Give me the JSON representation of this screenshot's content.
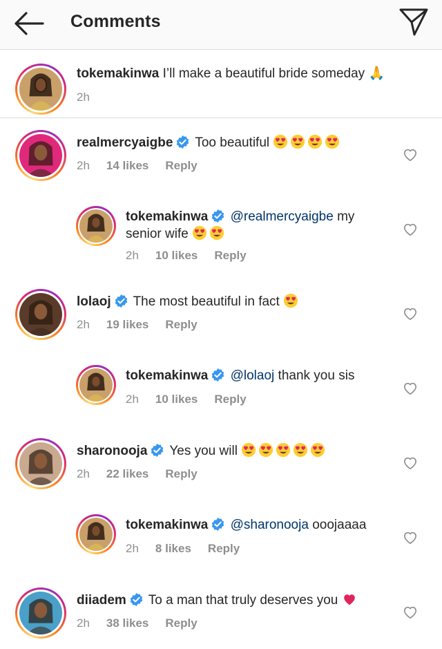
{
  "header": {
    "title": "Comments",
    "back_icon": "arrow-left-icon",
    "send_icon": "paper-plane-icon"
  },
  "caption": {
    "username": "tokemakinwa",
    "text": "I’ll make a beautiful bride someday",
    "emoji": "🙏",
    "time": "2h"
  },
  "comments": [
    {
      "username": "realmercyaigbe",
      "verified": true,
      "text": "Too beautiful",
      "emojis": [
        "😍",
        "😍",
        "😍",
        "😍"
      ],
      "time": "2h",
      "likes": "14 likes",
      "reply": "Reply",
      "avatar_color": "#e0297b"
    },
    {
      "username": "tokemakinwa",
      "verified": true,
      "mention": "@realmercyaigbe",
      "text": "my",
      "text2": "senior wife",
      "emojis": [
        "😍",
        "😍"
      ],
      "time": "2h",
      "likes": "10 likes",
      "reply": "Reply",
      "is_reply": true
    },
    {
      "username": "lolaoj",
      "verified": true,
      "text": "The most beautiful in fact",
      "emojis": [
        "😍"
      ],
      "time": "2h",
      "likes": "19 likes",
      "reply": "Reply",
      "avatar_color": "#5a3b2a"
    },
    {
      "username": "tokemakinwa",
      "verified": true,
      "mention": "@lolaoj",
      "text": "thank you sis",
      "time": "2h",
      "likes": "10 likes",
      "reply": "Reply",
      "is_reply": true
    },
    {
      "username": "sharonooja",
      "verified": true,
      "text": "Yes you will",
      "emojis": [
        "😍",
        "😍",
        "😍",
        "😍",
        "😍"
      ],
      "time": "2h",
      "likes": "22 likes",
      "reply": "Reply",
      "avatar_color": "#c9a990"
    },
    {
      "username": "tokemakinwa",
      "verified": true,
      "mention": "@sharonooja",
      "text": "ooojaaaa",
      "time": "2h",
      "likes": "8 likes",
      "reply": "Reply",
      "is_reply": true
    },
    {
      "username": "diiadem",
      "verified": true,
      "text": "To a man that truly deserves you",
      "emojis": [
        "❤️"
      ],
      "time": "2h",
      "likes": "38 likes",
      "reply": "Reply",
      "avatar_color": "#4aa0c8"
    }
  ],
  "colors": {
    "verified": "#3897f0",
    "mention": "#003569",
    "meta": "#8e8e8e",
    "heart_red": "#e0245e"
  }
}
